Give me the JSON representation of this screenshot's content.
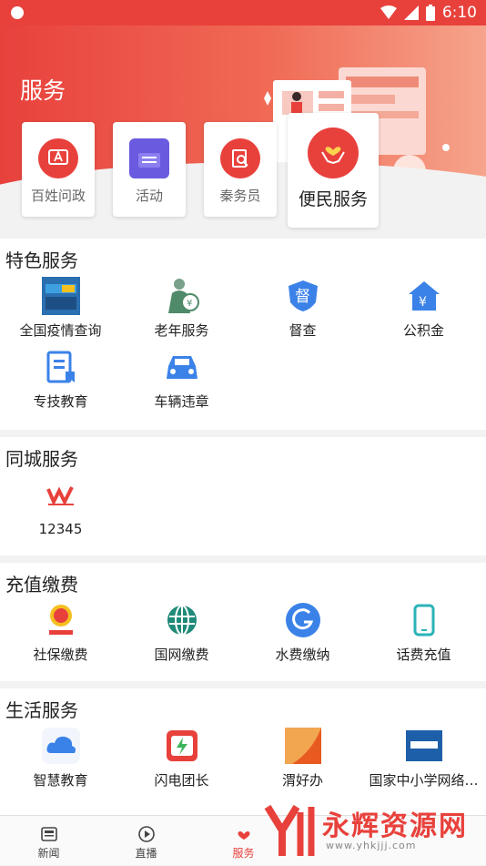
{
  "status": {
    "time": "6:10"
  },
  "hero": {
    "title": "服务"
  },
  "quick_services": [
    {
      "label": "百姓问政",
      "icon": "message-a-icon"
    },
    {
      "label": "活动",
      "icon": "signboard-icon"
    },
    {
      "label": "秦务员",
      "icon": "doc-search-icon"
    },
    {
      "label": "便民服务",
      "icon": "heart-hands-icon"
    }
  ],
  "featured": {
    "title": "特色服务",
    "items": [
      {
        "label": "全国疫情查询",
        "icon": "epidemic-query-icon"
      },
      {
        "label": "老年服务",
        "icon": "elderly-icon"
      },
      {
        "label": "督查",
        "icon": "inspection-badge-icon"
      },
      {
        "label": "公积金",
        "icon": "fund-house-icon"
      },
      {
        "label": "专技教育",
        "icon": "education-doc-icon"
      },
      {
        "label": "车辆违章",
        "icon": "car-icon"
      }
    ]
  },
  "city": {
    "title": "同城服务",
    "items": [
      {
        "label": "12345",
        "icon": "hotline-logo-icon"
      }
    ]
  },
  "recharge": {
    "title": "充值缴费",
    "items": [
      {
        "label": "社保缴费",
        "icon": "tax-emblem-icon"
      },
      {
        "label": "国网缴费",
        "icon": "state-grid-icon"
      },
      {
        "label": "水费缴纳",
        "icon": "water-icon"
      },
      {
        "label": "话费充值",
        "icon": "phone-icon"
      }
    ]
  },
  "life": {
    "title": "生活服务",
    "items": [
      {
        "label": "智慧教育",
        "icon": "cloud-education-icon"
      },
      {
        "label": "闪电团长",
        "icon": "lightning-icon"
      },
      {
        "label": "渭好办",
        "icon": "weihaoban-icon"
      },
      {
        "label": "国家中小学网络…",
        "icon": "national-school-icon"
      }
    ]
  },
  "tabs": [
    {
      "label": "新闻",
      "icon": "news-icon"
    },
    {
      "label": "直播",
      "icon": "play-icon"
    },
    {
      "label": "服务",
      "icon": "service-heart-icon",
      "active": true
    }
  ],
  "watermark": {
    "text": "永辉资源网",
    "url": "www.yhkjjj.com"
  },
  "colors": {
    "brand": "#e8413c",
    "blue": "#3b82e8",
    "teal": "#2bb3b8"
  }
}
